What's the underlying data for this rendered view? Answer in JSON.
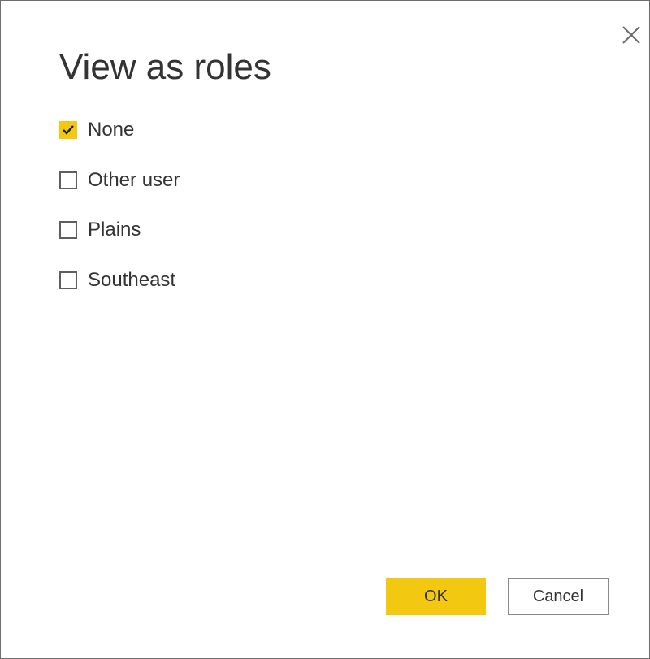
{
  "dialog": {
    "title": "View as roles",
    "close_icon": "close-icon"
  },
  "roles": [
    {
      "label": "None",
      "checked": true
    },
    {
      "label": "Other user",
      "checked": false
    },
    {
      "label": "Plains",
      "checked": false
    },
    {
      "label": "Southeast",
      "checked": false
    }
  ],
  "buttons": {
    "ok_label": "OK",
    "cancel_label": "Cancel"
  },
  "colors": {
    "accent": "#f2c811",
    "text": "#333333",
    "checkbox_border": "#5f5f5f"
  }
}
